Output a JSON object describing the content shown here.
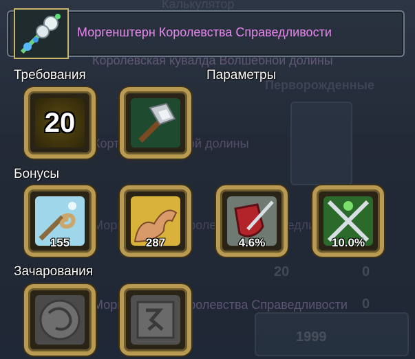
{
  "item": {
    "title": "Моргенштерн Королевства Справедливости",
    "icon": "morningstar-icon"
  },
  "sections": {
    "requirements": "Требования",
    "parameters": "Параметры",
    "bonuses": "Бонусы",
    "enchantments": "Зачарования"
  },
  "requirements": {
    "level": "20"
  },
  "parameters": {
    "weapon_type_icon": "hammer-icon"
  },
  "bonuses": [
    {
      "icon": "staff-icon",
      "value": "155"
    },
    {
      "icon": "strength-arm-icon",
      "value": "287"
    },
    {
      "icon": "crit-shield-icon",
      "value": "4.6%"
    },
    {
      "icon": "crossed-swords-icon",
      "value": "10.0%"
    }
  ],
  "enchantments": [
    {
      "icon": "stone-rune-icon-1"
    },
    {
      "icon": "stone-rune-icon-2"
    }
  ],
  "background": {
    "ghost_texts": [
      "Калькулятор",
      "Королевская кувалда Волшебной долины",
      "Перворожденные",
      "Кортик Волшебной долины",
      "Моргенштерн Королевства Справедливости",
      "Моргенштерн Королевства Справедливости"
    ],
    "ghost_numbers": [
      "20",
      "0",
      "0",
      "0",
      "1999"
    ]
  },
  "colors": {
    "title": "#e986ef",
    "frame_gold": "#b99a52",
    "label": "#ffffff"
  }
}
